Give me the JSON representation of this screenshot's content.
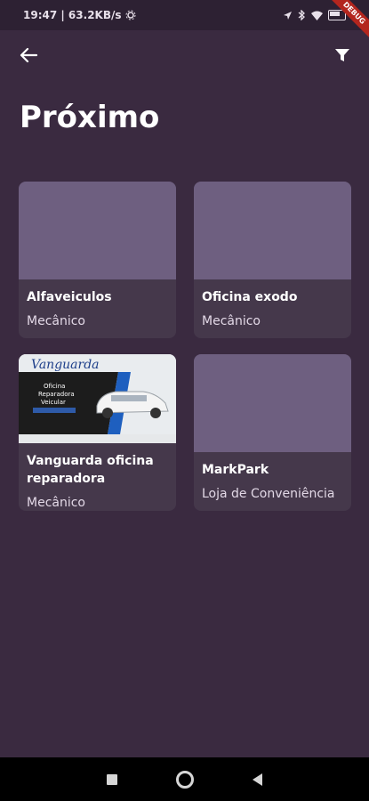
{
  "status_bar": {
    "time_speed": "19:47 | 63.2KB/s",
    "battery_icon": "battery-icon",
    "debug_label": "DEBUG"
  },
  "app_bar": {
    "back_icon": "arrow-left-icon",
    "filter_icon": "filter-icon"
  },
  "page": {
    "title": "Próximo"
  },
  "cards": [
    {
      "title": "Alfaveiculos",
      "category": "Mecânico",
      "has_image": false
    },
    {
      "title": "Oficina exodo",
      "category": "Mecânico",
      "has_image": false
    },
    {
      "title": "Vanguarda oficina reparadora",
      "category": "Mecânico",
      "has_image": true,
      "image_text": {
        "brand": "Vanguarda",
        "line1": "Oficina",
        "line2": "Reparadora",
        "line3": "Veicular"
      }
    },
    {
      "title": "MarkPark",
      "category": "Loja de Conveniência",
      "has_image": false
    }
  ],
  "colors": {
    "background": "#3a2a40",
    "card": "#45384b",
    "placeholder": "#6e5f80"
  },
  "nav_bar": {
    "recent_icon": "square-icon",
    "home_icon": "circle-icon",
    "back_icon": "triangle-back-icon"
  }
}
